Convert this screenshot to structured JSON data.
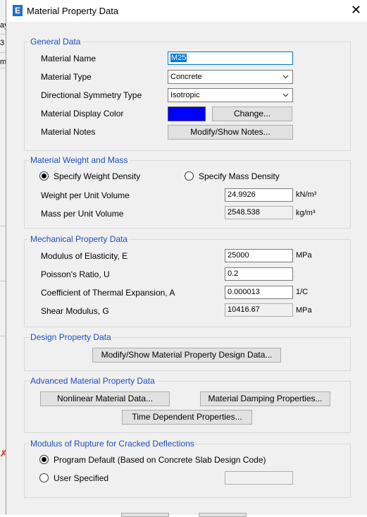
{
  "window": {
    "title": "Material Property Data",
    "app_icon_letter": "E",
    "close_glyph": "✕"
  },
  "background_fragments": [
    "ay",
    "3",
    "m"
  ],
  "general": {
    "legend": "General Data",
    "material_name_label": "Material Name",
    "material_name_value": "M25",
    "material_type_label": "Material Type",
    "material_type_value": "Concrete",
    "symmetry_label": "Directional Symmetry Type",
    "symmetry_value": "Isotropic",
    "display_color_label": "Material Display Color",
    "display_color": "#0000ff",
    "change_button": "Change...",
    "notes_label": "Material Notes",
    "notes_button": "Modify/Show Notes..."
  },
  "weight": {
    "legend": "Material Weight and Mass",
    "radio_weight": "Specify Weight Density",
    "radio_mass": "Specify Mass Density",
    "selected": "weight",
    "weight_label": "Weight per Unit Volume",
    "weight_value": "24.9926",
    "weight_unit": "kN/m³",
    "mass_label": "Mass per Unit Volume",
    "mass_value": "2548.538",
    "mass_unit": "kg/m³"
  },
  "mechanical": {
    "legend": "Mechanical Property Data",
    "e_label": "Modulus of Elasticity,  E",
    "e_value": "25000",
    "e_unit": "MPa",
    "u_label": "Poisson's Ratio,  U",
    "u_value": "0.2",
    "a_label": "Coefficient of Thermal Expansion,  A",
    "a_value": "0.000013",
    "a_unit": "1/C",
    "g_label": "Shear Modulus,  G",
    "g_value": "10416.67",
    "g_unit": "MPa"
  },
  "design": {
    "legend": "Design Property Data",
    "button": "Modify/Show Material Property Design Data..."
  },
  "advanced": {
    "legend": "Advanced Material Property Data",
    "nonlinear_button": "Nonlinear Material Data...",
    "damping_button": "Material Damping Properties...",
    "time_button": "Time Dependent Properties..."
  },
  "rupture": {
    "legend": "Modulus of Rupture for Cracked Deflections",
    "radio_default": "Program Default  (Based on Concrete Slab Design Code)",
    "radio_user": "User Specified",
    "selected": "default",
    "user_value": ""
  },
  "colors": {
    "legend": "#1a4fbf",
    "selection": "#0078d7",
    "dialog_bg": "#f0f0f0"
  }
}
